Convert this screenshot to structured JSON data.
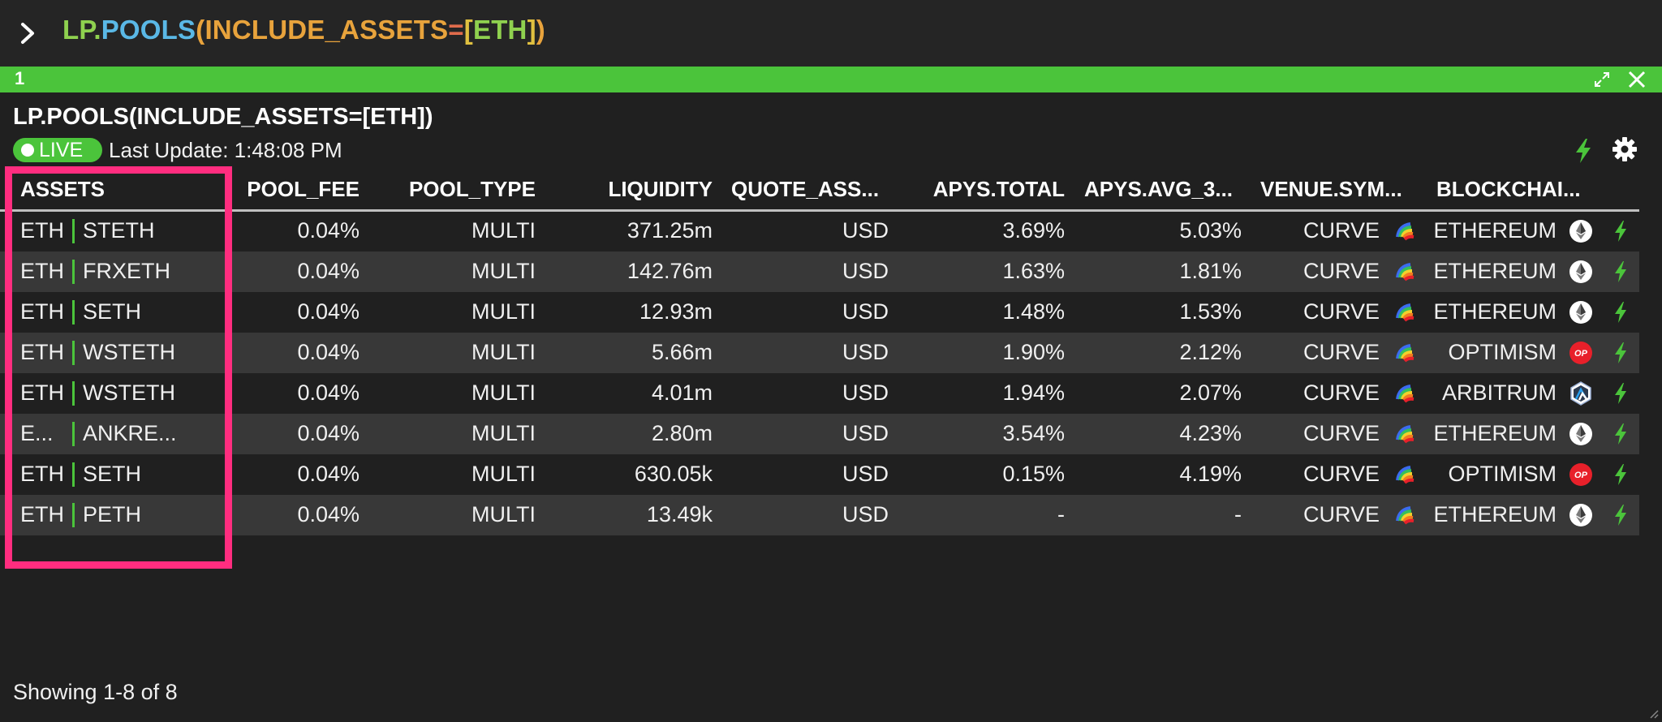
{
  "command": {
    "lp": "LP",
    "dot": ".",
    "pools": "POOLS",
    "open_paren": "(",
    "arg": "INCLUDE_ASSETS",
    "eq": "=",
    "open_br": "[",
    "asset": "ETH",
    "close_br": "]",
    "close_paren": ")"
  },
  "panel": {
    "number": "1",
    "title": "LP.POOLS(INCLUDE_ASSETS=[ETH])",
    "live_label": "LIVE",
    "last_update": "Last Update: 1:48:08 PM"
  },
  "table": {
    "columns": [
      "ASSETS",
      "POOL_FEE",
      "POOL_TYPE",
      "LIQUIDITY",
      "QUOTE_ASS...",
      "APYS.TOTAL",
      "APYS.AVG_3...",
      "VENUE.SYM...",
      "BLOCKCHAI..."
    ],
    "rows": [
      {
        "asset_a": "ETH",
        "asset_b": "STETH",
        "pool_fee": "0.04%",
        "pool_type": "MULTI",
        "liquidity": "371.25m",
        "quote": "USD",
        "apy_total": "3.69%",
        "apy_avg": "5.03%",
        "venue": "CURVE",
        "chain": "ETHEREUM",
        "chain_icon": "ethereum-icon"
      },
      {
        "asset_a": "ETH",
        "asset_b": "FRXETH",
        "pool_fee": "0.04%",
        "pool_type": "MULTI",
        "liquidity": "142.76m",
        "quote": "USD",
        "apy_total": "1.63%",
        "apy_avg": "1.81%",
        "venue": "CURVE",
        "chain": "ETHEREUM",
        "chain_icon": "ethereum-icon"
      },
      {
        "asset_a": "ETH",
        "asset_b": "SETH",
        "pool_fee": "0.04%",
        "pool_type": "MULTI",
        "liquidity": "12.93m",
        "quote": "USD",
        "apy_total": "1.48%",
        "apy_avg": "1.53%",
        "venue": "CURVE",
        "chain": "ETHEREUM",
        "chain_icon": "ethereum-icon"
      },
      {
        "asset_a": "ETH",
        "asset_b": "WSTETH",
        "pool_fee": "0.04%",
        "pool_type": "MULTI",
        "liquidity": "5.66m",
        "quote": "USD",
        "apy_total": "1.90%",
        "apy_avg": "2.12%",
        "venue": "CURVE",
        "chain": "OPTIMISM",
        "chain_icon": "optimism-icon"
      },
      {
        "asset_a": "ETH",
        "asset_b": "WSTETH",
        "pool_fee": "0.04%",
        "pool_type": "MULTI",
        "liquidity": "4.01m",
        "quote": "USD",
        "apy_total": "1.94%",
        "apy_avg": "2.07%",
        "venue": "CURVE",
        "chain": "ARBITRUM",
        "chain_icon": "arbitrum-icon"
      },
      {
        "asset_a": "E...",
        "asset_b": "ANKRE...",
        "pool_fee": "0.04%",
        "pool_type": "MULTI",
        "liquidity": "2.80m",
        "quote": "USD",
        "apy_total": "3.54%",
        "apy_avg": "4.23%",
        "venue": "CURVE",
        "chain": "ETHEREUM",
        "chain_icon": "ethereum-icon"
      },
      {
        "asset_a": "ETH",
        "asset_b": "SETH",
        "pool_fee": "0.04%",
        "pool_type": "MULTI",
        "liquidity": "630.05k",
        "quote": "USD",
        "apy_total": "0.15%",
        "apy_avg": "4.19%",
        "venue": "CURVE",
        "chain": "OPTIMISM",
        "chain_icon": "optimism-icon"
      },
      {
        "asset_a": "ETH",
        "asset_b": "PETH",
        "pool_fee": "0.04%",
        "pool_type": "MULTI",
        "liquidity": "13.49k",
        "quote": "USD",
        "apy_total": "-",
        "apy_avg": "-",
        "venue": "CURVE",
        "chain": "ETHEREUM",
        "chain_icon": "ethereum-icon"
      }
    ]
  },
  "footer": {
    "showing": "Showing 1-8 of 8"
  },
  "icons": {
    "prompt": "chevron-right-icon",
    "expand": "expand-icon",
    "close": "close-icon",
    "bolt": "lightning-bolt-icon",
    "gear": "gear-icon",
    "venue": "curve-logo-icon",
    "resize": "resize-handle-icon"
  },
  "optimism_badge": "OP",
  "colors": {
    "accent_green": "#4bc43b",
    "background": "#202020",
    "alt_row": "#383838",
    "highlight": "#ff2d7f",
    "optimism_red": "#e8202a"
  }
}
